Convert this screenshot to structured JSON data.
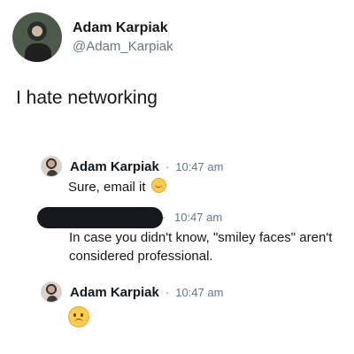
{
  "tweet": {
    "author": {
      "name": "Adam Karpiak",
      "handle": "@Adam_Karpiak"
    },
    "text": "I hate networking"
  },
  "thread": [
    {
      "name": "Adam Karpiak",
      "dot": "·",
      "time": "10:47 am",
      "body": "Sure, email it",
      "emoji": "smiling-face-icon"
    },
    {
      "name": "",
      "dot": "·",
      "time": "10:47 am",
      "body": "In case you didn't know, \"smiley faces\" aren't considered professional.",
      "redacted": true
    },
    {
      "name": "Adam Karpiak",
      "dot": "·",
      "time": "10:47 am",
      "body": "",
      "emoji": "frowning-face-icon"
    }
  ],
  "colors": {
    "text": "#14171a",
    "secondary": "#657786",
    "redaction": "#15181c",
    "emoji": "#ffcc4d"
  }
}
